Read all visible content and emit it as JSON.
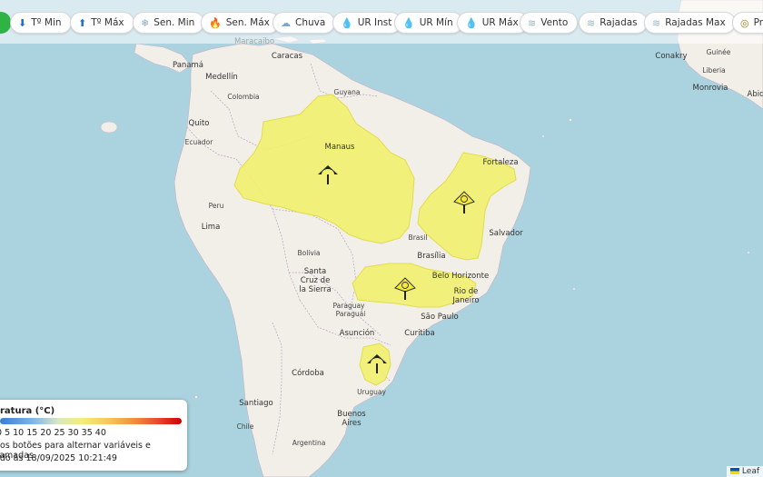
{
  "toolbar": {
    "buttons": [
      {
        "label": "Tº Min",
        "icon": "thermometer-down-icon",
        "glyph": "⬇"
      },
      {
        "label": "Tº Máx",
        "icon": "thermometer-up-icon",
        "glyph": "⬆"
      },
      {
        "label": "Sen. Min",
        "icon": "snowflake-icon",
        "glyph": "❄"
      },
      {
        "label": "Sen. Máx",
        "icon": "fire-icon",
        "glyph": "🔥"
      },
      {
        "label": "Chuva",
        "icon": "rain-cloud-icon",
        "glyph": "☁"
      },
      {
        "label": "UR Inst",
        "icon": "droplet-icon",
        "glyph": "💧"
      },
      {
        "label": "UR Mín",
        "icon": "droplet-icon",
        "glyph": "💧"
      },
      {
        "label": "UR Máx",
        "icon": "droplet-icon",
        "glyph": "💧"
      },
      {
        "label": "Vento",
        "icon": "wind-icon",
        "glyph": "≋"
      },
      {
        "label": "Rajadas",
        "icon": "wind-gust-icon",
        "glyph": "≋"
      },
      {
        "label": "Rajadas Max",
        "icon": "wind-gust-icon",
        "glyph": "≋"
      },
      {
        "label": "Pre",
        "icon": "pressure-gauge-icon",
        "glyph": "◎"
      }
    ]
  },
  "map": {
    "places": [
      "Maracaibo",
      "Caracas",
      "Panamá",
      "Medellín",
      "Colombia",
      "Quito",
      "Ecuador",
      "Guyana",
      "Manaus",
      "Fortaleza",
      "Peru",
      "Lima",
      "Brasil",
      "Salvador",
      "Brasília",
      "Bolivia",
      "Belo Horizonte",
      "Santa",
      "Cruz de",
      "la Sierra",
      "Rio de",
      "Janeiro",
      "Paraguay",
      "Paraguái",
      "São Paulo",
      "Asunción",
      "Curitiba",
      "Córdoba",
      "Uruguay",
      "Santiago",
      "Chile",
      "Buenos",
      "Aires",
      "Argentina",
      "Conakry",
      "Guinée",
      "Liberia",
      "Monrovia",
      "Abid"
    ],
    "alert_areas": [
      {
        "region": "Amazonas / North",
        "level": "yellow",
        "icon": "black-umbrella-alert-icon"
      },
      {
        "region": "Bahia / Northeast",
        "level": "yellow",
        "icon": "yellow-alert-icon"
      },
      {
        "region": "Goiás / Minas Gerais",
        "level": "yellow",
        "icon": "yellow-alert-icon"
      },
      {
        "region": "Rio Grande do Sul",
        "level": "yellow",
        "icon": "black-umbrella-alert-icon"
      }
    ],
    "colors": {
      "ocean": "#aad3df",
      "land": "#f2efe9",
      "alert": "#f1ef6e",
      "alert_border": "#e2dc4c"
    }
  },
  "legend": {
    "title": "ratura (°C)",
    "ticks": "0 5 10 15 20 25 30 35 40",
    "help": "nos botões para alternar variáveis e camadas.",
    "updated": "ado às 18/09/2025 10:21:49"
  },
  "attribution": {
    "text": "Leaf"
  }
}
